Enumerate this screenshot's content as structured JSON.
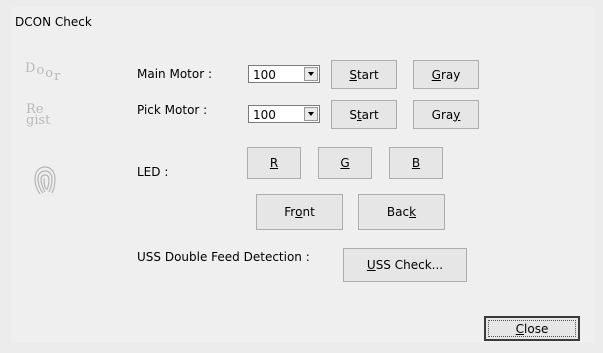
{
  "window": {
    "title": "DCON Check"
  },
  "side": {
    "door_letters": [
      "D",
      "o",
      "o",
      "r"
    ],
    "regist_line1": "Re",
    "regist_line2": "gist"
  },
  "main_motor": {
    "label": "Main Motor :",
    "value": "100",
    "start": {
      "pre": "",
      "u": "S",
      "post": "tart"
    },
    "gray": {
      "pre": "",
      "u": "G",
      "post": "ray"
    }
  },
  "pick_motor": {
    "label": "Pick Motor :",
    "value": "100",
    "start": {
      "pre": "S",
      "u": "t",
      "post": "art"
    },
    "gray": {
      "pre": "Gra",
      "u": "y",
      "post": ""
    }
  },
  "led": {
    "label": "LED :",
    "r": "R",
    "g": "G",
    "b": "B",
    "front": {
      "pre": "Fr",
      "u": "o",
      "post": "nt"
    },
    "back": {
      "pre": "Bac",
      "u": "k",
      "post": ""
    }
  },
  "uss": {
    "label": "USS Double Feed Detection :",
    "check": {
      "pre": "",
      "u": "U",
      "post": "SS Check..."
    }
  },
  "close": {
    "pre": "",
    "u": "C",
    "post": "lose"
  }
}
